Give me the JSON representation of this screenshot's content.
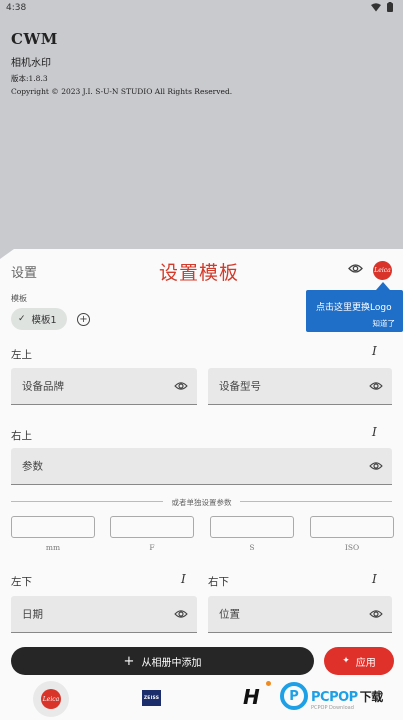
{
  "status_bar": {
    "time": "4:38"
  },
  "app_info": {
    "name": "CWM",
    "subtitle": "相机水印",
    "version": "版本:1.8.3",
    "copyright": "Copyright © 2023 J.I. S-U-N STUDIO All Rights Reserved."
  },
  "sheet": {
    "title": "设置",
    "overlay_title": "设置模板",
    "logo_text": "Leica",
    "tooltip": {
      "text": "点击这里更换Logo",
      "action": "知道了"
    }
  },
  "template": {
    "label": "模板",
    "chip_label": "模板1"
  },
  "sections": {
    "top_left": {
      "label": "左上",
      "fields": [
        "设备品牌",
        "设备型号"
      ]
    },
    "top_right": {
      "label": "右上",
      "field": "参数"
    },
    "divider_text": "或者单独设置参数",
    "params": [
      "mm",
      "F",
      "S",
      "ISO"
    ],
    "bottom_left": {
      "label": "左下",
      "field": "日期"
    },
    "bottom_right": {
      "label": "右下",
      "field": "位置"
    }
  },
  "buttons": {
    "gallery": "从相册中添加",
    "apply": "应用"
  },
  "brands": {
    "leica": "Leica",
    "zeiss": "ZEISS",
    "h": "H"
  },
  "watermark": {
    "letter": "P",
    "text": "PCPOP",
    "text_cn": "下载",
    "sub": "PCPOP Download"
  },
  "colors": {
    "accent_red": "#e0302a",
    "tooltip_blue": "#1f6ec8",
    "title_overlay": "#d23a2a"
  }
}
